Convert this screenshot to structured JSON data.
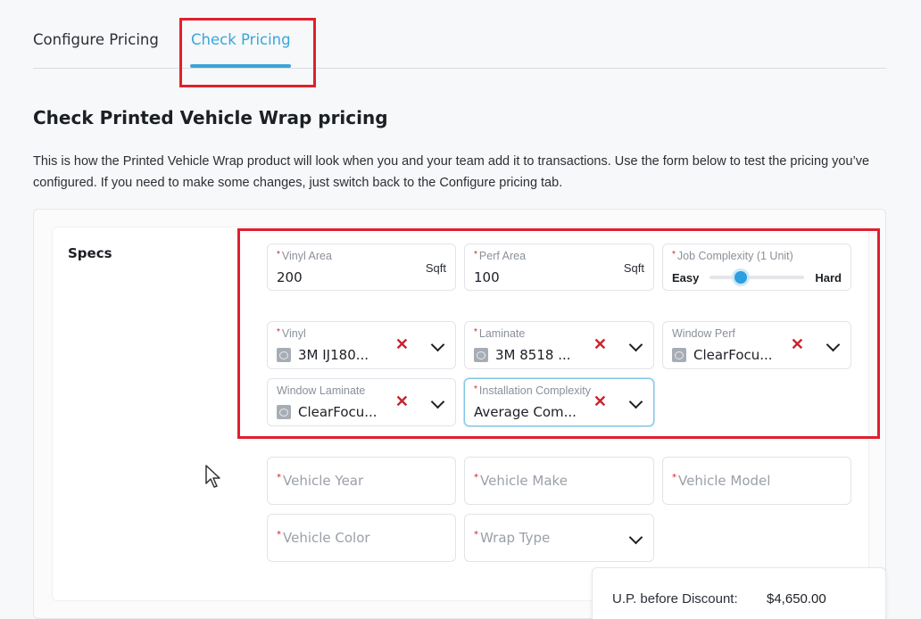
{
  "tabs": [
    {
      "label": "Configure Pricing",
      "active": false
    },
    {
      "label": "Check Pricing",
      "active": true
    }
  ],
  "page": {
    "title": "Check Printed Vehicle Wrap pricing",
    "description": "This is how the Printed Vehicle Wrap product will look when you and your team add it to transactions. Use the form below to test the pricing you’ve configured. If you need to make some changes, just switch back to the Configure pricing tab."
  },
  "specs": {
    "section_label": "Specs",
    "vinyl_area": {
      "label": "Vinyl Area",
      "value": "200",
      "unit": "Sqft"
    },
    "perf_area": {
      "label": "Perf Area",
      "value": "100",
      "unit": "Sqft"
    },
    "job_complexity": {
      "label": "Job Complexity (1 Unit)",
      "min_label": "Easy",
      "max_label": "Hard",
      "level": 0.33
    },
    "vinyl": {
      "label": "Vinyl",
      "value": "3M IJ180..."
    },
    "laminate": {
      "label": "Laminate",
      "value": "3M 8518 ..."
    },
    "window_perf": {
      "label": "Window Perf",
      "value": "ClearFocu..."
    },
    "window_laminate": {
      "label": "Window Laminate",
      "value": "ClearFocu..."
    },
    "installation_complexity": {
      "label": "Installation Complexity",
      "value": "Average Com..."
    },
    "vehicle_year": {
      "placeholder": "Vehicle Year"
    },
    "vehicle_make": {
      "placeholder": "Vehicle Make"
    },
    "vehicle_model": {
      "placeholder": "Vehicle Model"
    },
    "vehicle_color": {
      "placeholder": "Vehicle Color"
    },
    "wrap_type": {
      "placeholder": "Wrap Type"
    }
  },
  "summary": {
    "label": "U.P. before Discount:",
    "value": "$4,650.00"
  },
  "colors": {
    "accent": "#3aa6d9",
    "highlight_box": "#e0202e",
    "required_mark": "#d0212c"
  }
}
